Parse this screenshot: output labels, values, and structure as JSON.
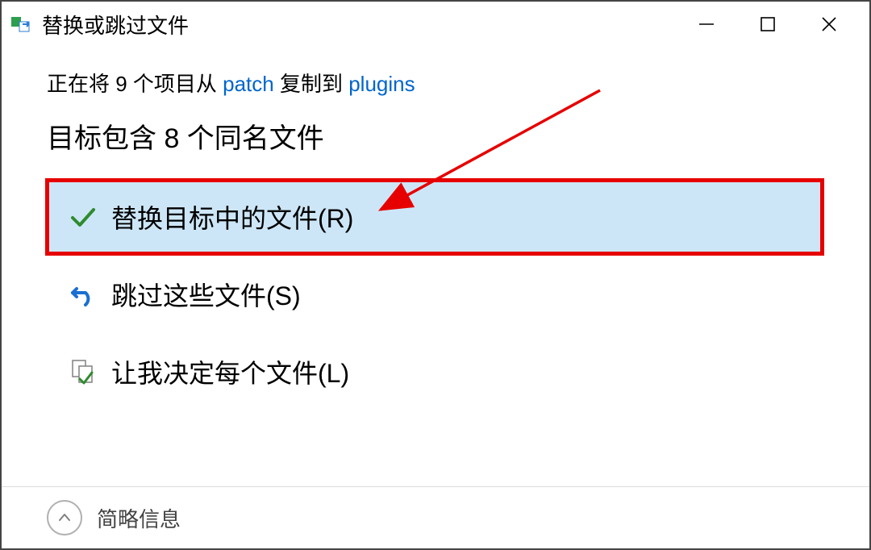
{
  "titlebar": {
    "title": "替换或跳过文件"
  },
  "copy_line": {
    "prefix": "正在将 9 个项目从 ",
    "source": "patch",
    "mid": " 复制到 ",
    "dest": "plugins"
  },
  "conflict_line": "目标包含 8 个同名文件",
  "options": {
    "replace": "替换目标中的文件(R)",
    "skip": "跳过这些文件(S)",
    "decide": "让我决定每个文件(L)"
  },
  "footer": {
    "brief_info": "简略信息"
  },
  "colors": {
    "link": "#0066cc",
    "selected_bg": "#cde6f7",
    "annotation_red": "#e60000",
    "check_green": "#2e8b2e",
    "undo_blue": "#1a6fd1"
  }
}
